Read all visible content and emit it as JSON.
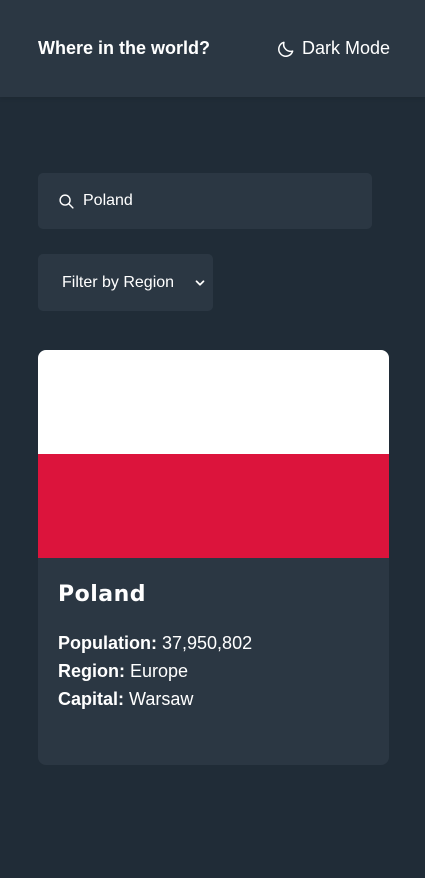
{
  "header": {
    "title": "Where in the world?",
    "theme_toggle_label": "Dark Mode",
    "theme_icon": "moon-icon"
  },
  "search": {
    "value": "Poland",
    "icon": "search-icon"
  },
  "filter": {
    "label": "Filter by Region",
    "icon": "chevron-down-icon"
  },
  "results": [
    {
      "name": "Poland",
      "flag_colors": [
        "#ffffff",
        "#dc143c"
      ],
      "population_label": "Population:",
      "population": "37,950,802",
      "region_label": "Region:",
      "region": "Europe",
      "capital_label": "Capital:",
      "capital": "Warsaw"
    }
  ],
  "colors": {
    "background": "#202c37",
    "elements": "#2b3743",
    "text": "#ffffff"
  }
}
